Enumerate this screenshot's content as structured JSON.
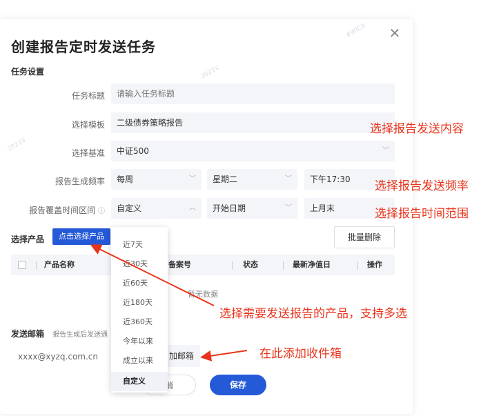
{
  "dialog": {
    "title": "创建报告定时发送任务",
    "section_task": "任务设置"
  },
  "form": {
    "task_title": {
      "label": "任务标题",
      "placeholder": "请输入任务标题"
    },
    "template": {
      "label": "选择模板",
      "value": "二级债券策略报告"
    },
    "benchmark": {
      "label": "选择基准",
      "value": "中证500"
    },
    "frequency": {
      "label": "报告生成频率",
      "unit": "每周",
      "day": "星期二",
      "time": "下午17:30"
    },
    "coverage": {
      "label": "报告覆盖时间区间",
      "mode": "自定义",
      "start": "开始日期",
      "end": "上月末"
    }
  },
  "products": {
    "label": "选择产品",
    "select_button": "点击选择产品",
    "batch_delete": "批量删除",
    "columns": [
      "产品名称",
      "备案号",
      "状态",
      "最新净值日",
      "操作"
    ],
    "empty": "暂无数据"
  },
  "dropdown": {
    "options": [
      "近7天",
      "近30天",
      "近60天",
      "近180天",
      "近360天",
      "今年以来",
      "成立以来",
      "自定义"
    ],
    "selected": "自定义"
  },
  "email": {
    "label": "发送邮箱",
    "hint": "报告生成后发送通",
    "address": "xxxx@xyzq.com.cn",
    "add_button": "加邮箱"
  },
  "footer": {
    "cancel": "消",
    "save": "保存"
  },
  "annotations": {
    "content": "选择报告发送内容",
    "frequency": "选择报告发送频率",
    "range": "选择报告时间范围",
    "products": "选择需要发送报告的产品，支持多选",
    "email": "在此添加收件箱"
  },
  "colors": {
    "primary": "#2459d8",
    "annotation": "#e8341c",
    "field_bg": "#f4f5f9"
  }
}
